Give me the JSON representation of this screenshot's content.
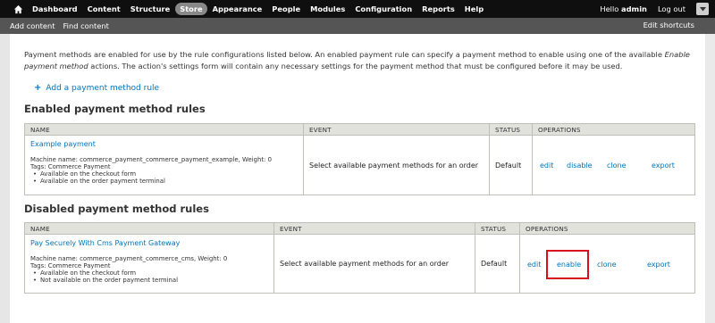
{
  "toolbar": {
    "home_icon": "home-icon",
    "items": [
      {
        "label": "Dashboard",
        "active": false
      },
      {
        "label": "Content",
        "active": false
      },
      {
        "label": "Structure",
        "active": false
      },
      {
        "label": "Store",
        "active": true
      },
      {
        "label": "Appearance",
        "active": false
      },
      {
        "label": "People",
        "active": false
      },
      {
        "label": "Modules",
        "active": false
      },
      {
        "label": "Configuration",
        "active": false
      },
      {
        "label": "Reports",
        "active": false
      },
      {
        "label": "Help",
        "active": false
      }
    ],
    "hello_prefix": "Hello",
    "username": "admin",
    "logout": "Log out"
  },
  "shortcuts": {
    "links": [
      "Add content",
      "Find content"
    ],
    "edit": "Edit shortcuts"
  },
  "intro": {
    "text_before": "Payment methods are enabled for use by the rule configurations listed below. An enabled payment rule can specify a payment method to enable using one of the available",
    "text_italic": "Enable payment method",
    "text_after": "actions. The action's settings form will contain any necessary settings for the payment method that must be configured before it may be used."
  },
  "add_rule": "Add a payment method rule",
  "enabled_section": {
    "title": "Enabled payment method rules",
    "headers": [
      "NAME",
      "EVENT",
      "STATUS",
      "OPERATIONS"
    ],
    "rows": [
      {
        "name": "Example payment",
        "machine": "Machine name: commerce_payment_commerce_payment_example, Weight: 0",
        "tags": "Tags: Commerce Payment",
        "bullets": [
          "Available on the checkout form",
          "Available on the order payment terminal"
        ],
        "event": "Select available payment methods for an order",
        "status": "Default",
        "ops": [
          "edit",
          "disable",
          "clone",
          "export"
        ]
      }
    ]
  },
  "disabled_section": {
    "title": "Disabled payment method rules",
    "headers": [
      "NAME",
      "EVENT",
      "STATUS",
      "OPERATIONS"
    ],
    "rows": [
      {
        "name": "Pay Securely With Cms Payment Gateway",
        "machine": "Machine name: commerce_payment_commerce_cms, Weight: 0",
        "tags": "Tags: Commerce Payment",
        "bullets": [
          "Available on the checkout form",
          "Not available on the order payment terminal"
        ],
        "event": "Select available payment methods for an order",
        "status": "Default",
        "ops": [
          "edit",
          "enable",
          "clone",
          "export"
        ]
      }
    ]
  },
  "colors": {
    "link": "#0074bd",
    "highlight": "#d80f1a",
    "toolbar": "#0f0f0f",
    "shortcuts": "#555555"
  }
}
